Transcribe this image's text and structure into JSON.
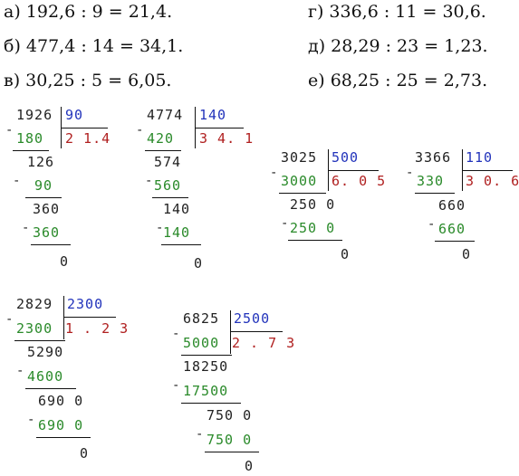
{
  "equations": [
    {
      "label": "а)",
      "text": "192,6 : 9 = 21,4."
    },
    {
      "label": "б)",
      "text": "477,4 : 14 = 34,1."
    },
    {
      "label": "в)",
      "text": "30,25 : 5 = 6,05."
    },
    {
      "label": "г)",
      "text": "336,6 : 11 = 30,6."
    },
    {
      "label": "д)",
      "text": "28,29 : 23 = 1,23."
    },
    {
      "label": "е)",
      "text": "68,25 : 25 = 2,73."
    }
  ],
  "divisions": [
    {
      "dividend": "1926",
      "divisor": "90",
      "quotient": "2 1.4",
      "steps": [
        "180",
        "126",
        "90",
        "360",
        "360",
        "0"
      ]
    },
    {
      "dividend": "4774",
      "divisor": "140",
      "quotient": "3 4. 1",
      "steps": [
        "420",
        "574",
        "560",
        "140",
        "140",
        "0"
      ]
    },
    {
      "dividend": "3025",
      "divisor": "500",
      "quotient": "6. 0 5",
      "steps": [
        "3000",
        "250 0",
        "250 0",
        "0"
      ]
    },
    {
      "dividend": "3366",
      "divisor": "110",
      "quotient": "3 0. 6",
      "steps": [
        "330",
        "660",
        "660",
        "0"
      ]
    },
    {
      "dividend": "2829",
      "divisor": "2300",
      "quotient": "1 . 2 3",
      "steps": [
        "2300",
        "5290",
        "4600",
        "690 0",
        "690 0",
        "0"
      ]
    },
    {
      "dividend": "6825",
      "divisor": "2500",
      "quotient": "2 . 7 3",
      "steps": [
        "5000",
        "18250",
        "17500",
        "750 0",
        "750 0",
        "0"
      ]
    }
  ]
}
